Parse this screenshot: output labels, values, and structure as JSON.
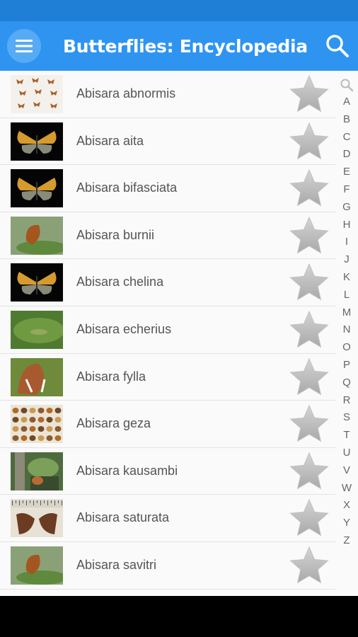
{
  "app_bar": {
    "title": "Butterflies: Encyclopedia",
    "menu_icon": "hamburger-menu-icon",
    "search_icon": "search-icon",
    "color": "#2f94f0",
    "status_bar_color": "#1f7fd6"
  },
  "species": [
    {
      "name": "Abisara abnormis",
      "thumb": "specimen-grid"
    },
    {
      "name": "Abisara aita",
      "thumb": "dark-spread"
    },
    {
      "name": "Abisara bifasciata",
      "thumb": "dark-spread"
    },
    {
      "name": "Abisara burnii",
      "thumb": "leaf-single"
    },
    {
      "name": "Abisara chelina",
      "thumb": "dark-spread"
    },
    {
      "name": "Abisara echerius",
      "thumb": "leaf-green"
    },
    {
      "name": "Abisara fylla",
      "thumb": "leaf-brown"
    },
    {
      "name": "Abisara geza",
      "thumb": "specimen-rows"
    },
    {
      "name": "Abisara kausambi",
      "thumb": "forest"
    },
    {
      "name": "Abisara saturata",
      "thumb": "ruler-specimen"
    },
    {
      "name": "Abisara savitri",
      "thumb": "leaf-single"
    }
  ],
  "alphabet_index": {
    "search_icon": "search-icon",
    "letters": [
      "A",
      "B",
      "C",
      "D",
      "E",
      "F",
      "G",
      "H",
      "I",
      "J",
      "K",
      "L",
      "M",
      "N",
      "O",
      "P",
      "Q",
      "R",
      "S",
      "T",
      "U",
      "V",
      "W",
      "X",
      "Y",
      "Z"
    ]
  },
  "favorite_icon": "star-icon"
}
